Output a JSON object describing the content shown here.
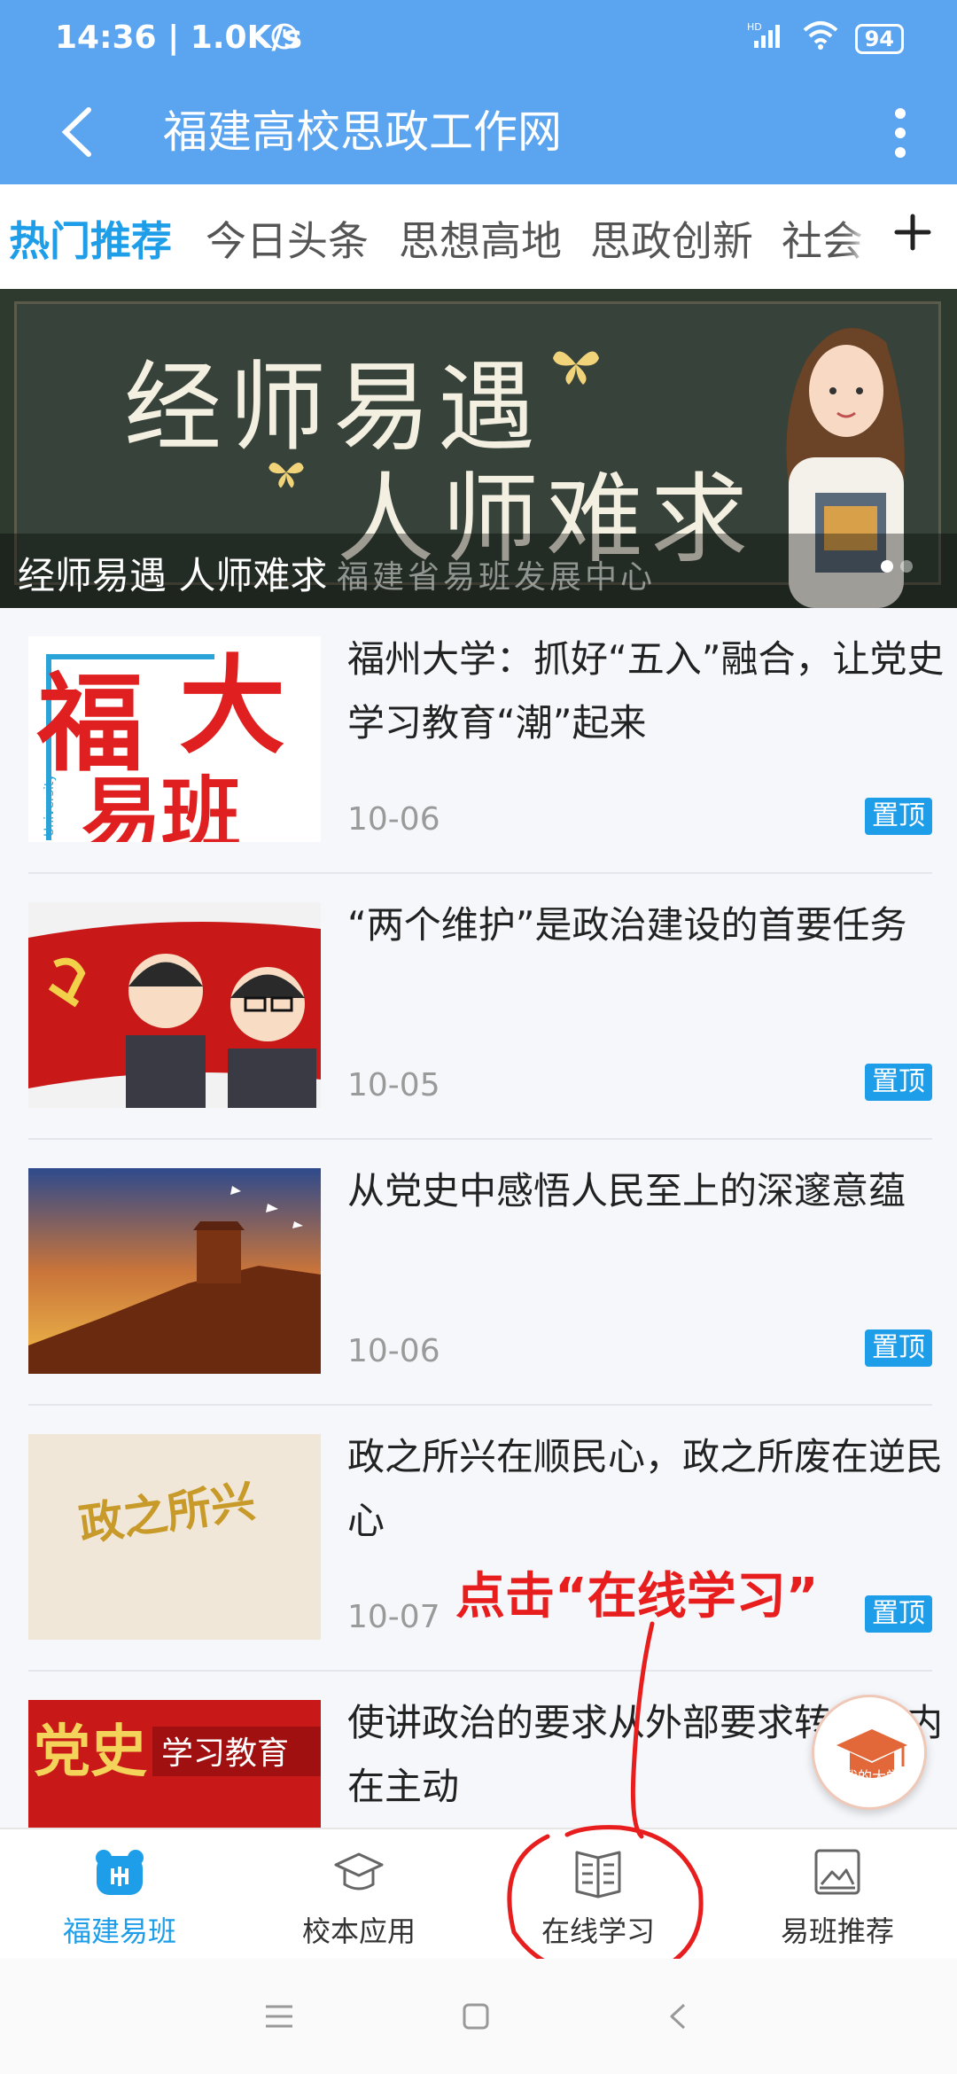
{
  "status_bar": {
    "time": "14:36 | 1.0K/s",
    "network": "HD",
    "battery": "94"
  },
  "app_bar": {
    "title": "福建高校思政工作网"
  },
  "tabs": [
    {
      "label": "热门推荐",
      "active": true
    },
    {
      "label": "今日头条",
      "active": false
    },
    {
      "label": "思想高地",
      "active": false
    },
    {
      "label": "思政创新",
      "active": false
    },
    {
      "label": "社会",
      "active": false
    }
  ],
  "banner": {
    "headline_line1": "经师易遇",
    "headline_line2": "人师难求",
    "caption": "经师易遇 人师难求",
    "watermark": "福建省易班发展中心"
  },
  "articles": [
    {
      "title": "福州大学：抓好“五入”融合，让党史学习教育“潮”起来",
      "date": "10-06",
      "badge": "置顶"
    },
    {
      "title": "“两个维护”是政治建设的首要任务",
      "date": "10-05",
      "badge": "置顶"
    },
    {
      "title": "从党史中感悟人民至上的深邃意蕴",
      "date": "10-06",
      "badge": "置顶"
    },
    {
      "title": "政之所兴在顺民心，政之所废在逆民心",
      "date": "10-07",
      "badge": "置顶"
    },
    {
      "title": "使讲政治的要求从外部要求转化为内在主动",
      "date": "",
      "badge": ""
    }
  ],
  "thumb_texts": {
    "fuda_a": "福",
    "fuda_b": "大",
    "fuda_c": "易班",
    "university": "University",
    "party_history": "党史",
    "study_edu": "学习教育",
    "calligraphy": "政之所兴"
  },
  "floating_badge": {
    "label": "我的大学"
  },
  "annotation": {
    "text": "点击“在线学习”"
  },
  "bottom_nav": [
    {
      "label": "福建易班",
      "icon": "home-bear-icon",
      "active": true
    },
    {
      "label": "校本应用",
      "icon": "graduation-cap-icon",
      "active": false
    },
    {
      "label": "在线学习",
      "icon": "book-icon",
      "active": false
    },
    {
      "label": "易班推荐",
      "icon": "picture-frame-icon",
      "active": false
    }
  ],
  "colors": {
    "primary": "#5ba4f0",
    "accent": "#1e9ee8",
    "annotation_red": "#e81e1e"
  }
}
